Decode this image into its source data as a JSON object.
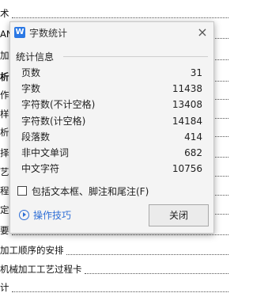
{
  "document": {
    "lines": [
      {
        "text": "术",
        "bold": false
      },
      {
        "text": "AN",
        "bold": false
      },
      {
        "text": "加工",
        "bold": false
      },
      {
        "text": "析",
        "bold": true
      },
      {
        "text": "作",
        "bold": false
      },
      {
        "text": "样",
        "bold": false
      },
      {
        "text": "析",
        "bold": false
      },
      {
        "text": "择",
        "bold": false
      },
      {
        "text": "艺",
        "bold": false
      },
      {
        "text": "程",
        "bold": false
      },
      {
        "text": "定",
        "bold": false
      },
      {
        "text": "要",
        "bold": false
      },
      {
        "text": "加工顺序的安排",
        "bold": false
      },
      {
        "text": "机械加工工艺过程卡",
        "bold": false
      },
      {
        "text": "计",
        "bold": false
      }
    ]
  },
  "dialog": {
    "title": "字数统计",
    "logo": "W",
    "close_icon": "×",
    "group_title": "统计信息",
    "stats": [
      {
        "label": "页数",
        "value": "31"
      },
      {
        "label": "字数",
        "value": "11438"
      },
      {
        "label": "字符数(不计空格)",
        "value": "13408"
      },
      {
        "label": "字符数(计空格)",
        "value": "14184"
      },
      {
        "label": "段落数",
        "value": "414"
      },
      {
        "label": "非中文单词",
        "value": "682"
      },
      {
        "label": "中文字符",
        "value": "10756"
      }
    ],
    "checkbox_label": "包括文本框、脚注和尾注(F)",
    "checkbox_checked": false,
    "tips_label": "操作技巧",
    "close_button_label": "关闭"
  }
}
